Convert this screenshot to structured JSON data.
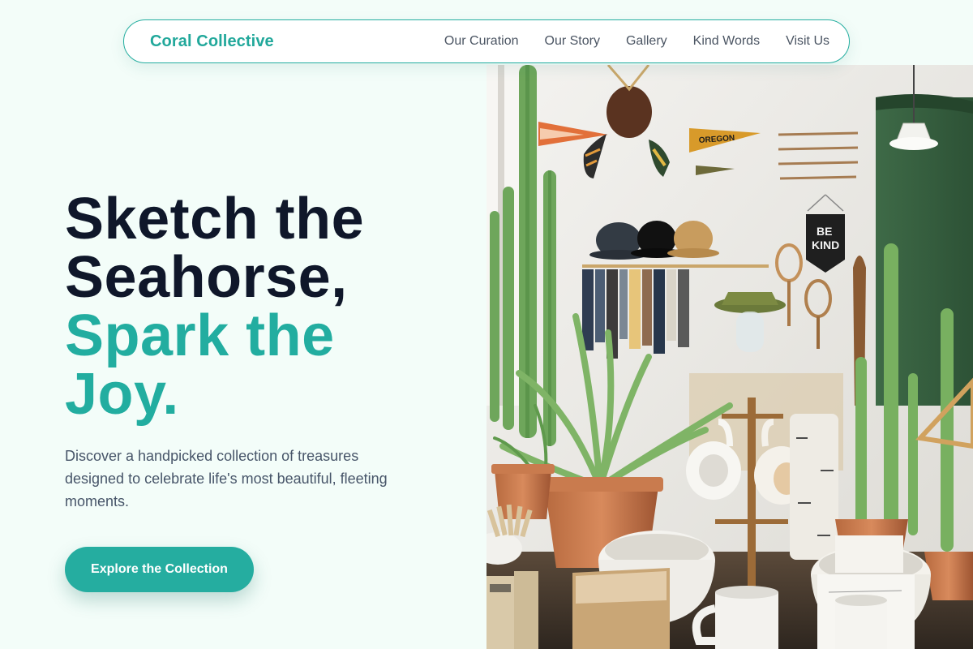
{
  "brand": {
    "name": "Coral Collective"
  },
  "nav": {
    "links": [
      "Our Curation",
      "Our Story",
      "Gallery",
      "Kind Words",
      "Visit Us"
    ]
  },
  "hero": {
    "headline_dark_1": "Sketch the",
    "headline_dark_2": "Seahorse,",
    "headline_teal_1": "Spark the",
    "headline_teal_2": "Joy.",
    "subtitle": "Discover a handpicked collection of treasures designed to celebrate life's most beautiful, fleeting moments.",
    "cta_label": "Explore the Collection"
  },
  "image": {
    "pennant_text": "OREGON",
    "banner_text_1": "BE",
    "banner_text_2": "KIND"
  },
  "colors": {
    "accent": "#22ada0",
    "heading": "#0f172a",
    "body_text": "#475569",
    "nav_text": "#4b5563",
    "page_bg": "#f3fdf9"
  }
}
